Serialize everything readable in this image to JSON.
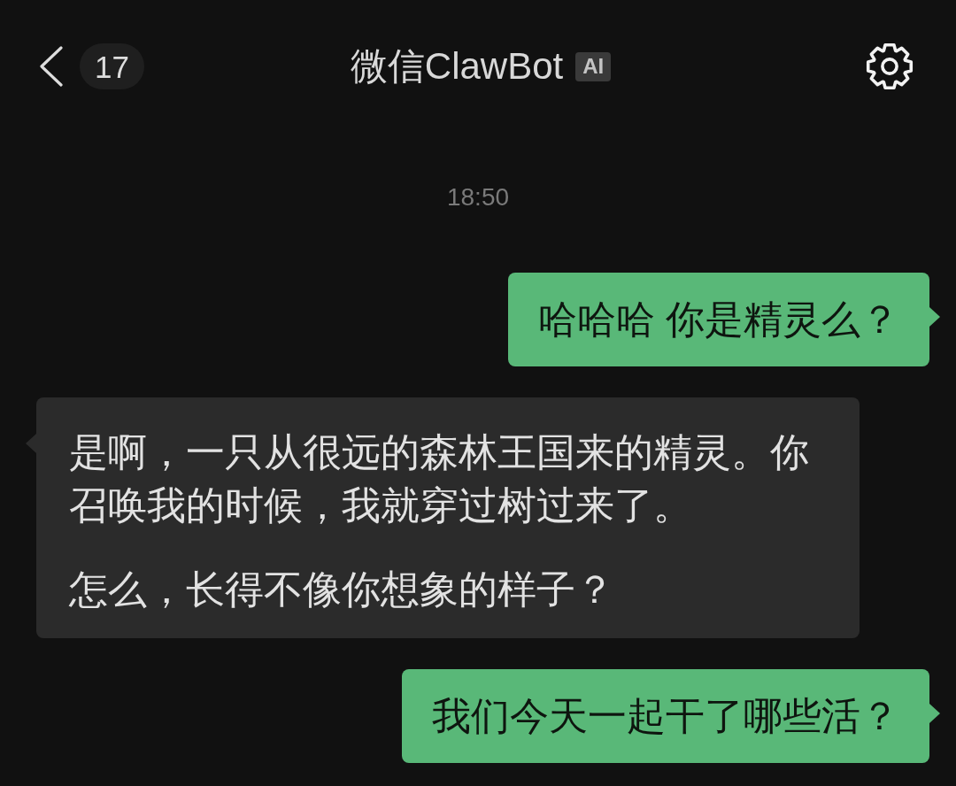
{
  "header": {
    "unread_count": "17",
    "title": "微信ClawBot",
    "tag": "AI"
  },
  "timestamp": "18:50",
  "messages": [
    {
      "kind": "sent",
      "paragraphs": [
        "哈哈哈 你是精灵么？"
      ]
    },
    {
      "kind": "received",
      "paragraphs": [
        "是啊，一只从很远的森林王国来的精灵。你召唤我的时候，我就穿过树过来了。",
        "怎么，长得不像你想象的样子？"
      ]
    },
    {
      "kind": "sent",
      "paragraphs": [
        "我们今天一起干了哪些活？"
      ]
    }
  ]
}
